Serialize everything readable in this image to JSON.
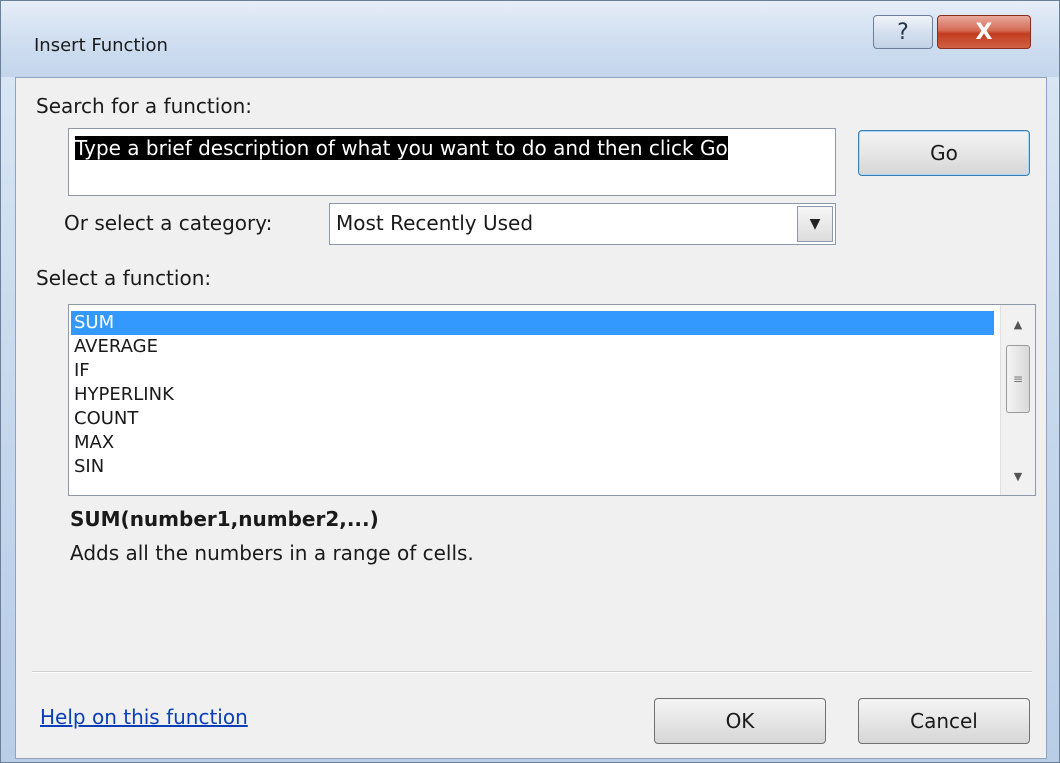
{
  "window": {
    "title": "Insert Function",
    "help_symbol": "?",
    "close_symbol": "X"
  },
  "search": {
    "label": "Search for a function:",
    "value": "Type a brief description of what you want to do and then click Go",
    "go_label": "Go"
  },
  "category": {
    "label": "Or select a category:",
    "selected": "Most Recently Used",
    "arrow_glyph": "▼"
  },
  "functions": {
    "label": "Select a function:",
    "items": [
      "SUM",
      "AVERAGE",
      "IF",
      "HYPERLINK",
      "COUNT",
      "MAX",
      "SIN"
    ],
    "selected": "SUM",
    "scroll_up_glyph": "▲",
    "scroll_down_glyph": "▼",
    "scroll_thumb_glyph": "≡"
  },
  "details": {
    "signature": "SUM(number1,number2,...)",
    "description": "Adds all the numbers in a range of cells."
  },
  "footer": {
    "help_link": "Help on this function",
    "ok_label": "OK",
    "cancel_label": "Cancel"
  },
  "colors": {
    "selection": "#3399ff",
    "link": "#0b3fb8",
    "close_button": "#c23c1f"
  }
}
